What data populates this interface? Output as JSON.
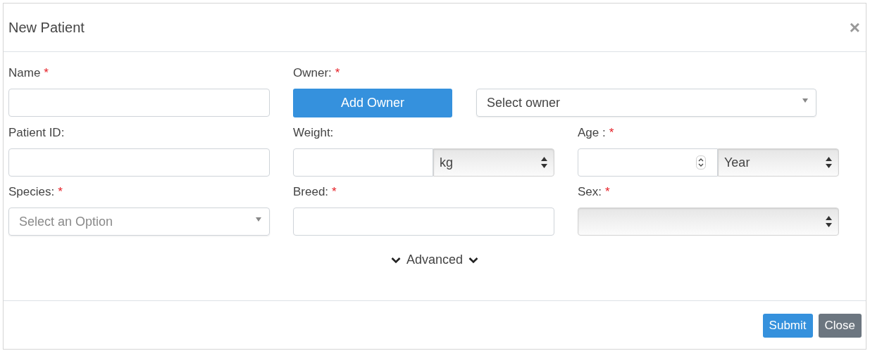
{
  "dialog": {
    "title": "New Patient",
    "close": "×"
  },
  "rows": [
    [
      {
        "kind": "text",
        "label": "Name",
        "required": "*"
      },
      {
        "kind": "owner",
        "label": "Owner:",
        "required": "*",
        "button": "Add Owner",
        "value": "Select owner"
      }
    ],
    [
      {
        "kind": "text",
        "label": "Patient ID:"
      },
      {
        "kind": "unit",
        "label": "Weight:",
        "unit": "kg"
      },
      {
        "kind": "number_unit",
        "label": "Age :",
        "required": "*",
        "unit": "Year"
      }
    ],
    [
      {
        "kind": "combo",
        "label": "Species:",
        "required": "*",
        "placeholder": "Select an Option"
      },
      {
        "kind": "text",
        "label": "Breed:",
        "required": "*"
      },
      {
        "kind": "native_select",
        "label": "Sex:",
        "required": "*"
      }
    ]
  ],
  "advanced": {
    "label": "Advanced",
    "expanded": false
  },
  "buttons": [
    {
      "label": "Submit",
      "kind": "primary"
    },
    {
      "label": "Close",
      "kind": "secondary"
    }
  ]
}
